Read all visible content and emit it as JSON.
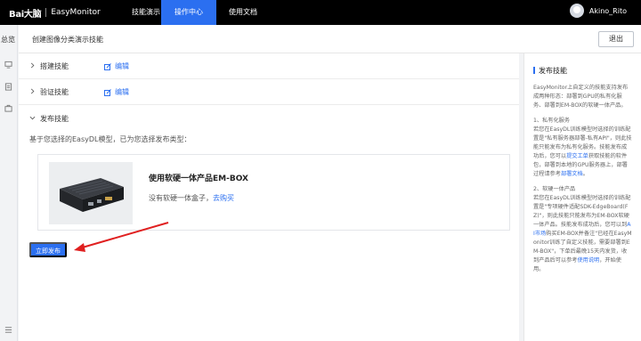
{
  "topbar": {
    "logo_brand": "Bai大脑",
    "logo_product": "EasyMonitor",
    "nav": [
      "技能演示",
      "操作中心",
      "使用文档"
    ],
    "active_nav": "操作中心",
    "user_name": "Akino_Rito"
  },
  "sidebar": {
    "title": "总览",
    "icons": [
      "monitor-icon",
      "list-icon",
      "briefcase-icon",
      "menu-icon"
    ]
  },
  "subheader": {
    "title": "创建图像分类演示技能",
    "exit_label": "退出"
  },
  "sections": [
    {
      "label": "搭建技能",
      "edit_label": "编辑"
    },
    {
      "label": "验证技能",
      "edit_label": "编辑"
    },
    {
      "label": "发布技能"
    }
  ],
  "publish": {
    "description": "基于您选择的EasyDL模型，已为您选择发布类型：",
    "product_title": "使用软硬一体产品EM-BOX",
    "product_hint": "没有软硬一体盒子，",
    "product_link": "去购买",
    "button_label": "立即发布"
  },
  "help": {
    "title": "发布技能",
    "intro": "EasyMonitor上自定义的技能支持发布成两种形态：部署到GPU的私有化服务、部署到EM-BOX的软硬一体产品。",
    "p1_title": "1、私有化服务",
    "p1_a": "若您在EasyDL训练模型时选择的训练配置是\"私有服务器部署-私有API\"，则此技能只能发布为私有化服务。技能发布成功后，您可以",
    "p1_link1": "提交工单",
    "p1_b": "获取技能的软件包，部署到本地的GPU服务器上，部署过程请参考",
    "p1_link2": "部署文档",
    "p1_c": "。",
    "p2_title": "2、软硬一体产品",
    "p2_a": "若您在EasyDL训练模型时选择的训练配置是\"专项硬件适配SDK-EdgeBoard(FZ)\"，则此技能只能发布为EM-BOX软硬一体产品。技能发布成功后，您可以到",
    "p2_link1": "AI市场",
    "p2_b": "购买EM-BOX并备注\"已经在EasyMonitor训练了自定义技能，需要部署到EM-BOX\"，下单后最晚15天内发货，收到产品后可以参考",
    "p2_link2": "使用说明",
    "p2_c": "，开始使用。"
  },
  "colors": {
    "accent": "#2b6ff0",
    "topbar": "#000000",
    "annotation_arrow": "#e02020"
  }
}
